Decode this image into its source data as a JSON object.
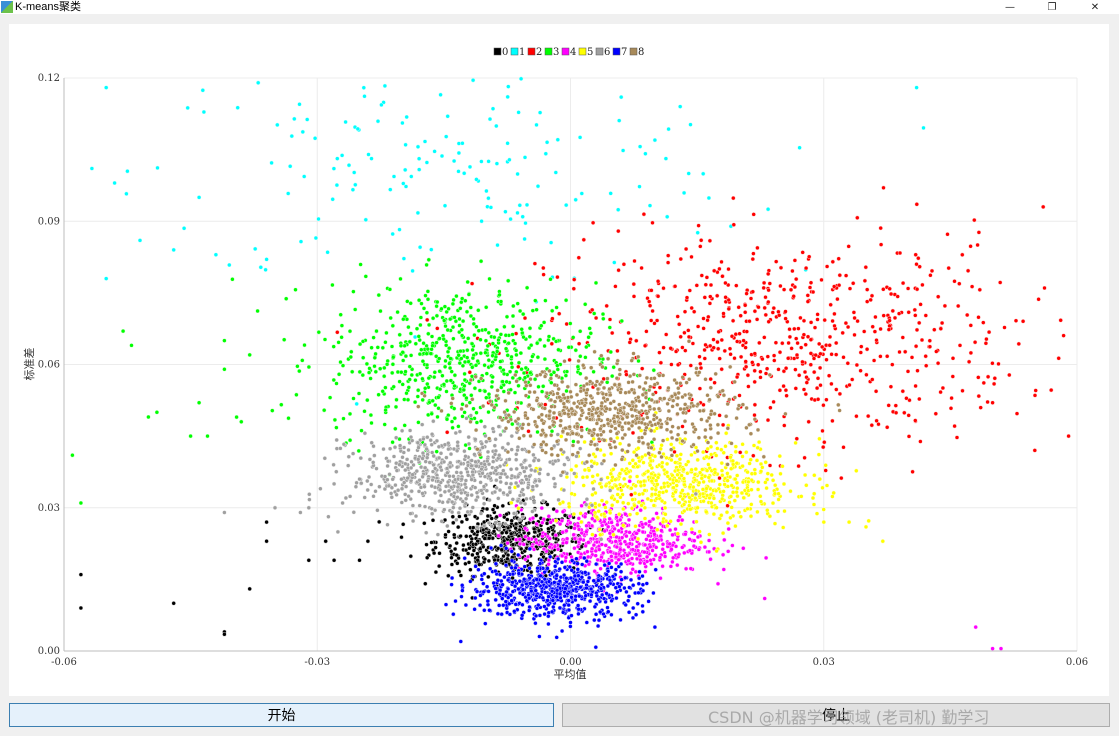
{
  "window": {
    "title": "K-means聚类",
    "minimize_label": "—",
    "maximize_label": "❐",
    "close_label": "✕"
  },
  "controls": {
    "start_label": "开始",
    "stop_label": "停止"
  },
  "watermark": "CSDN @机器学习领域 (老司机) 勤学习",
  "chart_data": {
    "type": "scatter",
    "title": "",
    "xlabel": "平均值",
    "ylabel": "标准差",
    "xlim": [
      -0.06,
      0.06
    ],
    "ylim": [
      0,
      0.12
    ],
    "xticks": [
      "-0.06",
      "-0.03",
      "0.00",
      "0.03",
      "0.06"
    ],
    "yticks": [
      "0.00",
      "0.03",
      "0.06",
      "0.09",
      "0.12"
    ],
    "grid": true,
    "legend_position": "top-center",
    "series": [
      {
        "name": "0",
        "color": "#000000",
        "center": [
          -0.007,
          0.023
        ],
        "spread": [
          0.0045,
          0.0035
        ],
        "count": 520,
        "outliers": [
          [
            -0.058,
            0.016
          ],
          [
            -0.058,
            0.009
          ],
          [
            -0.047,
            0.01
          ],
          [
            -0.041,
            0.004
          ],
          [
            -0.041,
            0.0035
          ],
          [
            -0.038,
            0.013
          ],
          [
            -0.036,
            0.023
          ],
          [
            -0.036,
            0.027
          ],
          [
            -0.031,
            0.019
          ],
          [
            -0.029,
            0.023
          ],
          [
            -0.028,
            0.019
          ],
          [
            -0.025,
            0.019
          ],
          [
            -0.024,
            0.023
          ]
        ]
      },
      {
        "name": "1",
        "color": "#00ffff",
        "center": [
          -0.015,
          0.1
        ],
        "spread": [
          0.018,
          0.012
        ],
        "count": 160,
        "outliers": [
          [
            -0.055,
            0.118
          ],
          [
            -0.054,
            0.098
          ],
          [
            -0.055,
            0.078
          ],
          [
            -0.051,
            0.086
          ],
          [
            -0.047,
            0.084
          ],
          [
            -0.044,
            0.095
          ],
          [
            -0.042,
            0.083
          ],
          [
            -0.037,
            0.119
          ],
          [
            -0.036,
            0.082
          ],
          [
            0.006,
            0.116
          ],
          [
            0.01,
            0.107
          ],
          [
            0.013,
            0.114
          ],
          [
            0.014,
            0.1
          ],
          [
            0.041,
            0.118
          ]
        ]
      },
      {
        "name": "2",
        "color": "#ff0000",
        "center": [
          0.025,
          0.065
        ],
        "spread": [
          0.014,
          0.011
        ],
        "count": 900,
        "outliers": [
          [
            0.056,
            0.093
          ],
          [
            0.059,
            0.045
          ],
          [
            0.055,
            0.042
          ],
          [
            0.05,
            0.052
          ]
        ]
      },
      {
        "name": "3",
        "color": "#00ff00",
        "center": [
          -0.013,
          0.061
        ],
        "spread": [
          0.008,
          0.008
        ],
        "count": 1100,
        "outliers": [
          [
            -0.059,
            0.041
          ],
          [
            -0.058,
            0.031
          ],
          [
            -0.053,
            0.067
          ],
          [
            -0.052,
            0.064
          ],
          [
            -0.05,
            0.049
          ],
          [
            -0.049,
            0.05
          ],
          [
            -0.045,
            0.045
          ],
          [
            -0.044,
            0.052
          ],
          [
            -0.043,
            0.045
          ],
          [
            -0.041,
            0.065
          ],
          [
            -0.041,
            0.059
          ],
          [
            -0.039,
            0.048
          ],
          [
            -0.038,
            0.062
          ]
        ]
      },
      {
        "name": "4",
        "color": "#ff00ff",
        "center": [
          0.005,
          0.023
        ],
        "spread": [
          0.0055,
          0.0035
        ],
        "count": 520,
        "outliers": [
          [
            0.023,
            0.011
          ],
          [
            0.048,
            0.005
          ],
          [
            0.05,
            0.0005
          ],
          [
            0.051,
            0.0005
          ]
        ]
      },
      {
        "name": "5",
        "color": "#ffff00",
        "center": [
          0.013,
          0.035
        ],
        "spread": [
          0.007,
          0.0045
        ],
        "count": 850,
        "outliers": [
          [
            0.03,
            0.027
          ],
          [
            0.033,
            0.027
          ],
          [
            0.035,
            0.026
          ],
          [
            0.037,
            0.023
          ]
        ]
      },
      {
        "name": "6",
        "color": "#a0a0a0",
        "center": [
          -0.013,
          0.037
        ],
        "spread": [
          0.0065,
          0.0045
        ],
        "count": 1000,
        "outliers": [
          [
            -0.041,
            0.029
          ],
          [
            -0.035,
            0.03
          ],
          [
            -0.032,
            0.029
          ],
          [
            -0.031,
            0.03
          ],
          [
            -0.028,
            0.035
          ],
          [
            -0.027,
            0.031
          ],
          [
            -0.025,
            0.036
          ]
        ]
      },
      {
        "name": "7",
        "color": "#0000ff",
        "center": [
          -0.002,
          0.013
        ],
        "spread": [
          0.005,
          0.003
        ],
        "count": 820,
        "outliers": [
          [
            -0.013,
            0.002
          ],
          [
            0.01,
            0.005
          ],
          [
            0.003,
            0.0008
          ]
        ]
      },
      {
        "name": "8",
        "color": "#a88a5a",
        "center": [
          0.005,
          0.05
        ],
        "spread": [
          0.0075,
          0.0045
        ],
        "count": 900,
        "outliers": []
      }
    ]
  }
}
